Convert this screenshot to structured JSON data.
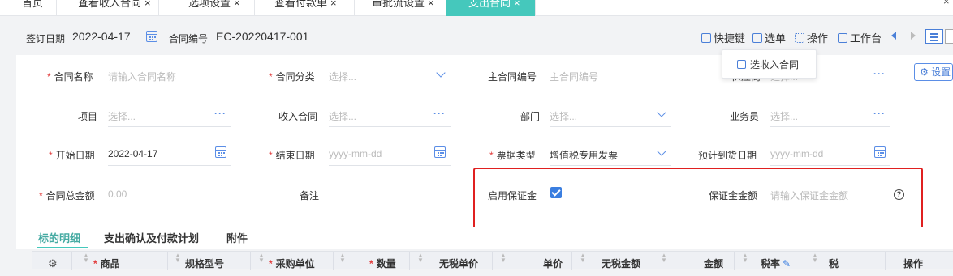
{
  "tabs": [
    {
      "label": "首页",
      "closable": false
    },
    {
      "label": "查看收入合同",
      "closable": true
    },
    {
      "label": "选项设置",
      "closable": true
    },
    {
      "label": "查看付款单",
      "closable": true
    },
    {
      "label": "审批流设置",
      "closable": true
    },
    {
      "label": "支出合同",
      "closable": true,
      "active": true
    }
  ],
  "header": {
    "sign_date_label": "签订日期",
    "sign_date_value": "2022-04-17",
    "contract_no_label": "合同编号",
    "contract_no_value": "EC-20220417-001",
    "tools": [
      "快捷键",
      "选单",
      "操作",
      "工作台"
    ]
  },
  "popup": {
    "item": "选收入合同"
  },
  "settings_label": "设置",
  "form": {
    "contract_name": {
      "label": "合同名称",
      "placeholder": "请输入合同名称"
    },
    "contract_category": {
      "label": "合同分类",
      "placeholder": "选择..."
    },
    "main_contract_no": {
      "label": "主合同编号",
      "placeholder": "主合同编号"
    },
    "supplier": {
      "label": "供应商",
      "placeholder": "选择..."
    },
    "project": {
      "label": "项目",
      "placeholder": "选择..."
    },
    "income_contract": {
      "label": "收入合同",
      "placeholder": "选择..."
    },
    "department": {
      "label": "部门",
      "placeholder": "选择..."
    },
    "salesperson": {
      "label": "业务员",
      "placeholder": "选择..."
    },
    "start_date": {
      "label": "开始日期",
      "value": "2022-04-17"
    },
    "end_date": {
      "label": "结束日期",
      "placeholder": "yyyy-mm-dd"
    },
    "invoice_type": {
      "label": "票据类型",
      "value": "增值税专用发票"
    },
    "expected_arrival": {
      "label": "预计到货日期",
      "placeholder": "yyyy-mm-dd"
    },
    "total_amount": {
      "label": "合同总金额",
      "placeholder": "0.00"
    },
    "remarks": {
      "label": "备注"
    },
    "enable_deposit": {
      "label": "启用保证金",
      "checked": true
    },
    "deposit_amount": {
      "label": "保证金金额",
      "placeholder": "请输入保证金金额"
    }
  },
  "detail_tabs": [
    "标的明细",
    "支出确认及付款计划",
    "附件"
  ],
  "table_headers": [
    "商品",
    "规格型号",
    "采购单位",
    "数量",
    "无税单价",
    "单价",
    "无税金额",
    "金额",
    "税率",
    "税",
    "操作"
  ],
  "colors": {
    "accent": "#45c8bc",
    "primary": "#3a7ee0",
    "required": "#e23d3d",
    "highlight_box": "#e02020"
  }
}
